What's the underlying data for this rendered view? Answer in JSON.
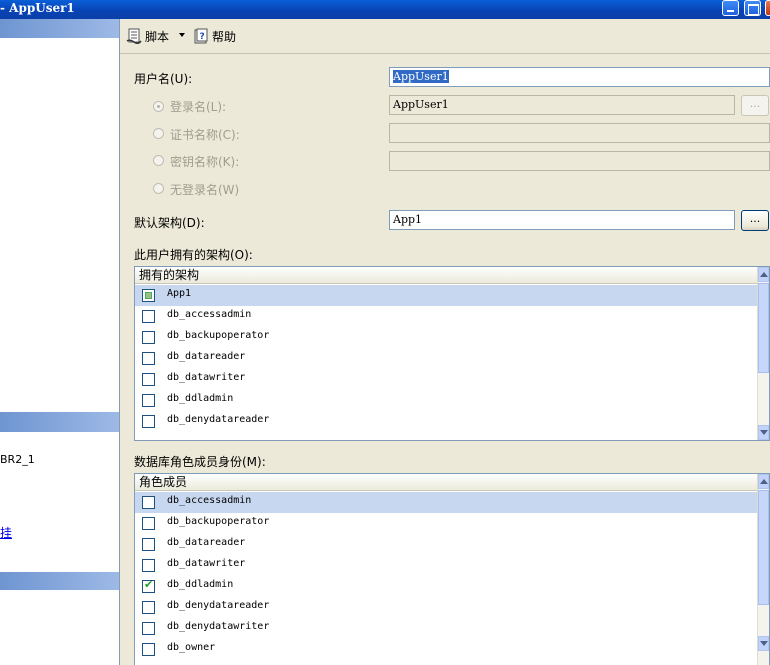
{
  "window": {
    "title": "- AppUser1"
  },
  "left_panel": {
    "server_text": "BR2_1",
    "link_text": "挂"
  },
  "toolbar": {
    "script_label": "脚本",
    "help_label": "帮助"
  },
  "form": {
    "username_label": "用户名(U):",
    "username_value": "AppUser1",
    "login_name_label": "登录名(L):",
    "login_name_value": "AppUser1",
    "cert_name_label": "证书名称(C):",
    "key_name_label": "密钥名称(K):",
    "no_login_label": "无登录名(W)",
    "default_schema_label": "默认架构(D):",
    "default_schema_value": "App1",
    "browse_label": "..."
  },
  "owned_schemas": {
    "label": "此用户拥有的架构(O):",
    "column_header": "拥有的架构",
    "items": [
      {
        "name": "App1",
        "state": "mixed",
        "selected": true
      },
      {
        "name": "db_accessadmin",
        "state": "unchecked"
      },
      {
        "name": "db_backupoperator",
        "state": "unchecked"
      },
      {
        "name": "db_datareader",
        "state": "unchecked"
      },
      {
        "name": "db_datawriter",
        "state": "unchecked"
      },
      {
        "name": "db_ddladmin",
        "state": "unchecked"
      },
      {
        "name": "db_denydatareader",
        "state": "unchecked"
      }
    ]
  },
  "role_membership": {
    "label": "数据库角色成员身份(M):",
    "column_header": "角色成员",
    "items": [
      {
        "name": "db_accessadmin",
        "state": "unchecked",
        "selected": true
      },
      {
        "name": "db_backupoperator",
        "state": "unchecked"
      },
      {
        "name": "db_datareader",
        "state": "unchecked"
      },
      {
        "name": "db_datawriter",
        "state": "unchecked"
      },
      {
        "name": "db_ddladmin",
        "state": "checked"
      },
      {
        "name": "db_denydatareader",
        "state": "unchecked"
      },
      {
        "name": "db_denydatawriter",
        "state": "unchecked"
      },
      {
        "name": "db_owner",
        "state": "unchecked"
      }
    ]
  }
}
